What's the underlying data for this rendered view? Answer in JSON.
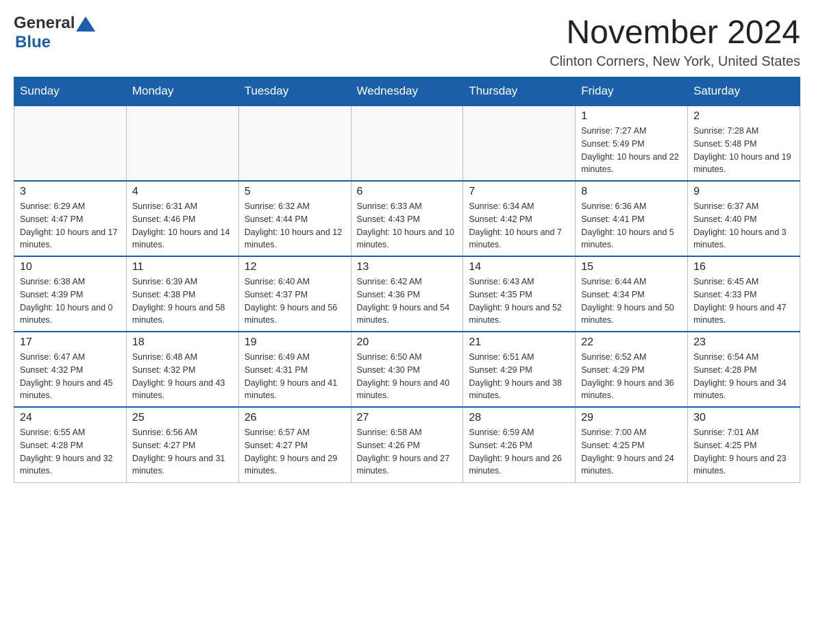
{
  "header": {
    "logo": {
      "general": "General",
      "blue": "Blue",
      "triangle_color": "#1a5fa8"
    },
    "title": "November 2024",
    "location": "Clinton Corners, New York, United States"
  },
  "calendar": {
    "days_of_week": [
      "Sunday",
      "Monday",
      "Tuesday",
      "Wednesday",
      "Thursday",
      "Friday",
      "Saturday"
    ],
    "weeks": [
      {
        "cells": [
          {
            "day": "",
            "info": ""
          },
          {
            "day": "",
            "info": ""
          },
          {
            "day": "",
            "info": ""
          },
          {
            "day": "",
            "info": ""
          },
          {
            "day": "",
            "info": ""
          },
          {
            "day": "1",
            "info": "Sunrise: 7:27 AM\nSunset: 5:49 PM\nDaylight: 10 hours and 22 minutes."
          },
          {
            "day": "2",
            "info": "Sunrise: 7:28 AM\nSunset: 5:48 PM\nDaylight: 10 hours and 19 minutes."
          }
        ]
      },
      {
        "cells": [
          {
            "day": "3",
            "info": "Sunrise: 6:29 AM\nSunset: 4:47 PM\nDaylight: 10 hours and 17 minutes."
          },
          {
            "day": "4",
            "info": "Sunrise: 6:31 AM\nSunset: 4:46 PM\nDaylight: 10 hours and 14 minutes."
          },
          {
            "day": "5",
            "info": "Sunrise: 6:32 AM\nSunset: 4:44 PM\nDaylight: 10 hours and 12 minutes."
          },
          {
            "day": "6",
            "info": "Sunrise: 6:33 AM\nSunset: 4:43 PM\nDaylight: 10 hours and 10 minutes."
          },
          {
            "day": "7",
            "info": "Sunrise: 6:34 AM\nSunset: 4:42 PM\nDaylight: 10 hours and 7 minutes."
          },
          {
            "day": "8",
            "info": "Sunrise: 6:36 AM\nSunset: 4:41 PM\nDaylight: 10 hours and 5 minutes."
          },
          {
            "day": "9",
            "info": "Sunrise: 6:37 AM\nSunset: 4:40 PM\nDaylight: 10 hours and 3 minutes."
          }
        ]
      },
      {
        "cells": [
          {
            "day": "10",
            "info": "Sunrise: 6:38 AM\nSunset: 4:39 PM\nDaylight: 10 hours and 0 minutes."
          },
          {
            "day": "11",
            "info": "Sunrise: 6:39 AM\nSunset: 4:38 PM\nDaylight: 9 hours and 58 minutes."
          },
          {
            "day": "12",
            "info": "Sunrise: 6:40 AM\nSunset: 4:37 PM\nDaylight: 9 hours and 56 minutes."
          },
          {
            "day": "13",
            "info": "Sunrise: 6:42 AM\nSunset: 4:36 PM\nDaylight: 9 hours and 54 minutes."
          },
          {
            "day": "14",
            "info": "Sunrise: 6:43 AM\nSunset: 4:35 PM\nDaylight: 9 hours and 52 minutes."
          },
          {
            "day": "15",
            "info": "Sunrise: 6:44 AM\nSunset: 4:34 PM\nDaylight: 9 hours and 50 minutes."
          },
          {
            "day": "16",
            "info": "Sunrise: 6:45 AM\nSunset: 4:33 PM\nDaylight: 9 hours and 47 minutes."
          }
        ]
      },
      {
        "cells": [
          {
            "day": "17",
            "info": "Sunrise: 6:47 AM\nSunset: 4:32 PM\nDaylight: 9 hours and 45 minutes."
          },
          {
            "day": "18",
            "info": "Sunrise: 6:48 AM\nSunset: 4:32 PM\nDaylight: 9 hours and 43 minutes."
          },
          {
            "day": "19",
            "info": "Sunrise: 6:49 AM\nSunset: 4:31 PM\nDaylight: 9 hours and 41 minutes."
          },
          {
            "day": "20",
            "info": "Sunrise: 6:50 AM\nSunset: 4:30 PM\nDaylight: 9 hours and 40 minutes."
          },
          {
            "day": "21",
            "info": "Sunrise: 6:51 AM\nSunset: 4:29 PM\nDaylight: 9 hours and 38 minutes."
          },
          {
            "day": "22",
            "info": "Sunrise: 6:52 AM\nSunset: 4:29 PM\nDaylight: 9 hours and 36 minutes."
          },
          {
            "day": "23",
            "info": "Sunrise: 6:54 AM\nSunset: 4:28 PM\nDaylight: 9 hours and 34 minutes."
          }
        ]
      },
      {
        "cells": [
          {
            "day": "24",
            "info": "Sunrise: 6:55 AM\nSunset: 4:28 PM\nDaylight: 9 hours and 32 minutes."
          },
          {
            "day": "25",
            "info": "Sunrise: 6:56 AM\nSunset: 4:27 PM\nDaylight: 9 hours and 31 minutes."
          },
          {
            "day": "26",
            "info": "Sunrise: 6:57 AM\nSunset: 4:27 PM\nDaylight: 9 hours and 29 minutes."
          },
          {
            "day": "27",
            "info": "Sunrise: 6:58 AM\nSunset: 4:26 PM\nDaylight: 9 hours and 27 minutes."
          },
          {
            "day": "28",
            "info": "Sunrise: 6:59 AM\nSunset: 4:26 PM\nDaylight: 9 hours and 26 minutes."
          },
          {
            "day": "29",
            "info": "Sunrise: 7:00 AM\nSunset: 4:25 PM\nDaylight: 9 hours and 24 minutes."
          },
          {
            "day": "30",
            "info": "Sunrise: 7:01 AM\nSunset: 4:25 PM\nDaylight: 9 hours and 23 minutes."
          }
        ]
      }
    ]
  }
}
